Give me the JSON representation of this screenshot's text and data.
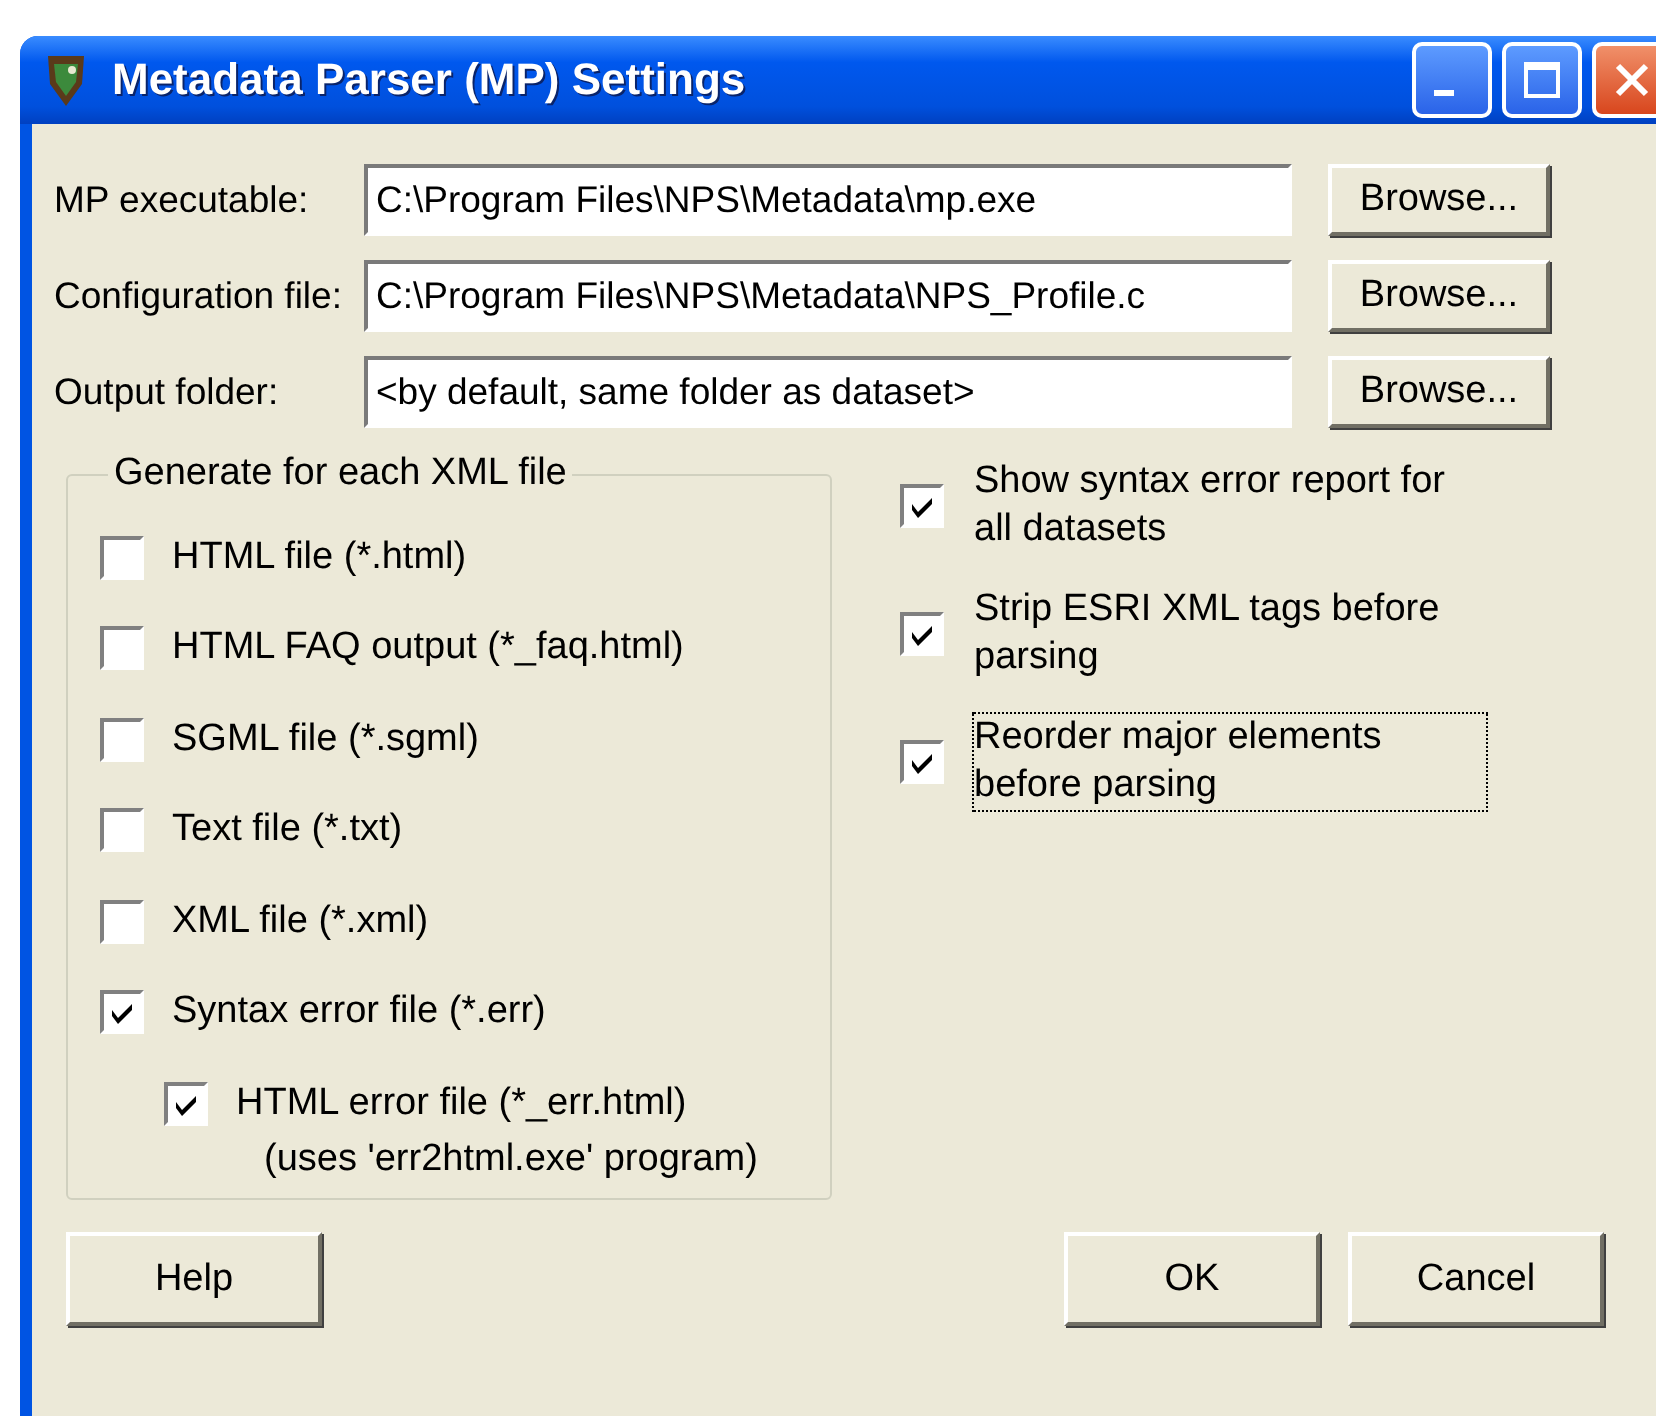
{
  "window": {
    "title": "Metadata Parser (MP) Settings"
  },
  "paths": [
    {
      "label": "MP executable:",
      "value": "C:\\Program Files\\NPS\\Metadata\\mp.exe",
      "button": "Browse..."
    },
    {
      "label": "Configuration file:",
      "value": "C:\\Program Files\\NPS\\Metadata\\NPS_Profile.c",
      "button": "Browse..."
    },
    {
      "label": "Output folder:",
      "value": "<by default, same folder as dataset>",
      "button": "Browse..."
    }
  ],
  "generate": {
    "title": "Generate for each XML file",
    "options": [
      {
        "label": "HTML file  (*.html)",
        "checked": false
      },
      {
        "label": "HTML FAQ output (*_faq.html)",
        "checked": false
      },
      {
        "label": "SGML file (*.sgml)",
        "checked": false
      },
      {
        "label": "Text file (*.txt)",
        "checked": false
      },
      {
        "label": "XML file (*.xml)",
        "checked": false
      },
      {
        "label": "Syntax error file (*.err)",
        "checked": true,
        "children": [
          {
            "label": "HTML error file (*_err.html)",
            "checked": true,
            "note": "(uses 'err2html.exe' program)"
          }
        ]
      }
    ]
  },
  "options": [
    {
      "label": "Show syntax error report for all datasets",
      "checked": true,
      "focused": false
    },
    {
      "label": "Strip ESRI XML tags before parsing",
      "checked": true,
      "focused": false
    },
    {
      "label": "Reorder major elements before parsing",
      "checked": true,
      "focused": true
    }
  ],
  "buttons": [
    {
      "label": "Help"
    },
    {
      "label": "OK"
    },
    {
      "label": "Cancel"
    }
  ]
}
